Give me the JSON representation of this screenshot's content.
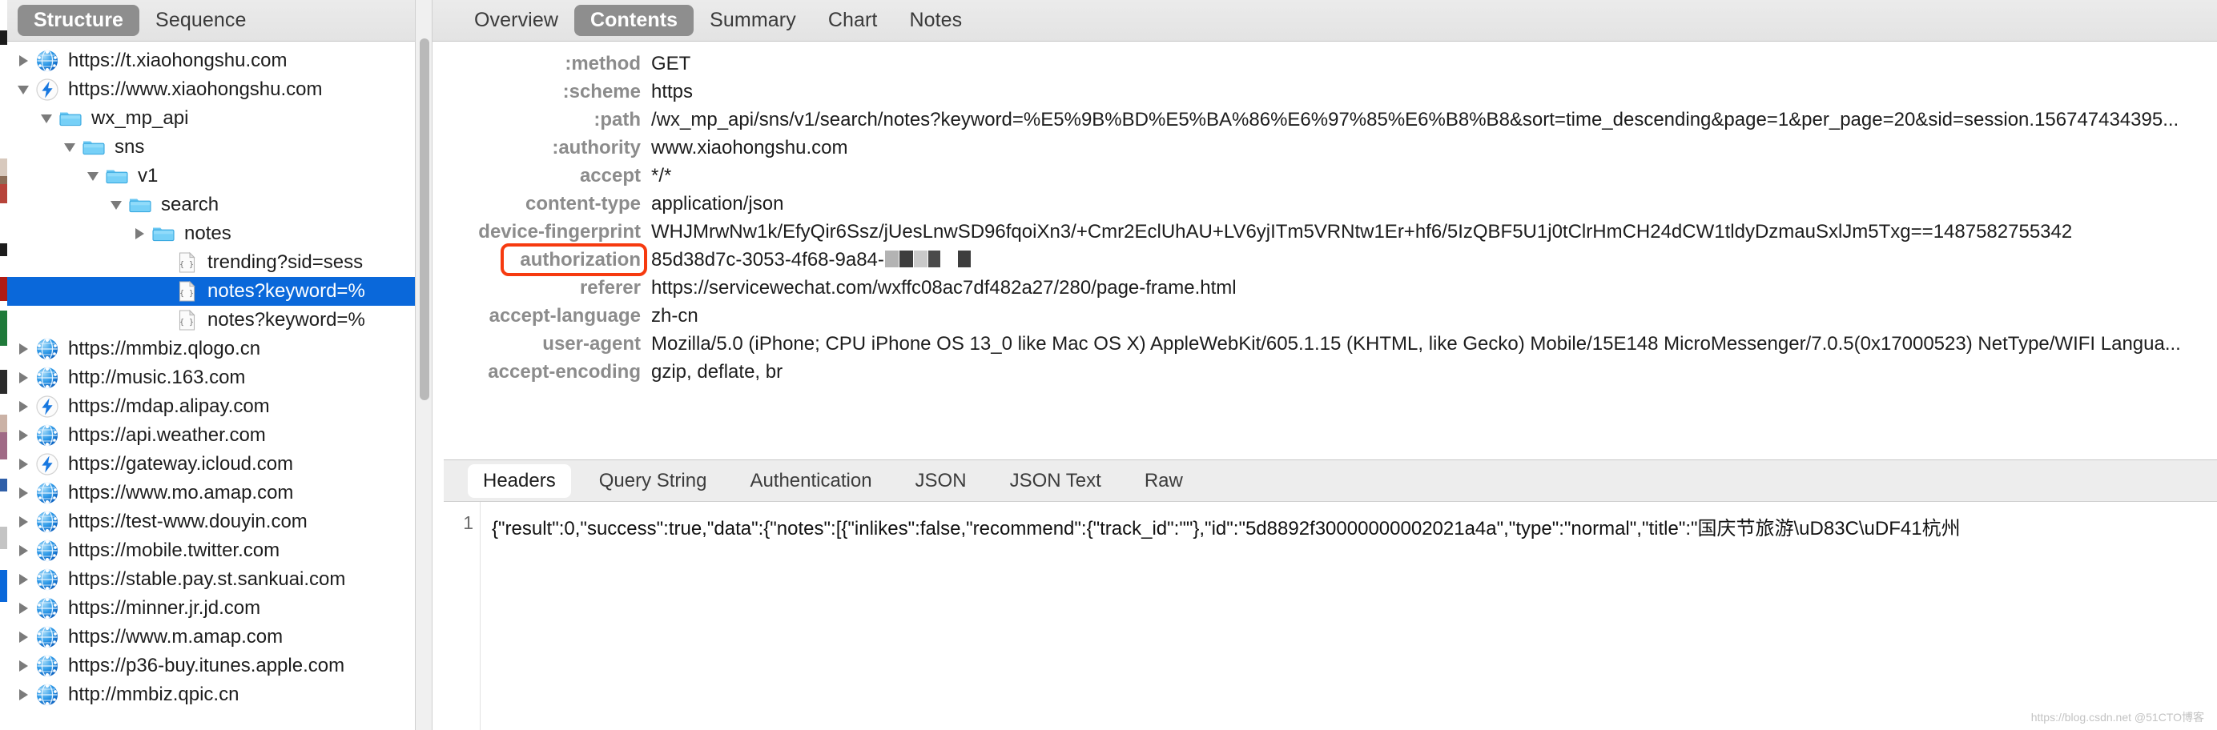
{
  "left_panel": {
    "tabs": [
      {
        "label": "Structure",
        "active": true
      },
      {
        "label": "Sequence",
        "active": false
      }
    ],
    "tree": [
      {
        "label": "https://t.xiaohongshu.com",
        "icon": "globe-icon",
        "indent": 0,
        "twisty": "closed",
        "selected": false
      },
      {
        "label": "https://www.xiaohongshu.com",
        "icon": "bolt-icon",
        "indent": 0,
        "twisty": "open",
        "selected": false
      },
      {
        "label": "wx_mp_api",
        "icon": "folder-icon",
        "indent": 1,
        "twisty": "open",
        "selected": false
      },
      {
        "label": "sns",
        "icon": "folder-icon",
        "indent": 2,
        "twisty": "open",
        "selected": false
      },
      {
        "label": "v1",
        "icon": "folder-icon",
        "indent": 3,
        "twisty": "open",
        "selected": false
      },
      {
        "label": "search",
        "icon": "folder-icon",
        "indent": 4,
        "twisty": "open",
        "selected": false
      },
      {
        "label": "notes",
        "icon": "folder-icon",
        "indent": 5,
        "twisty": "closed",
        "selected": false
      },
      {
        "label": "trending?sid=sess",
        "icon": "json-doc-icon",
        "indent": 6,
        "twisty": "none",
        "selected": false
      },
      {
        "label": "notes?keyword=%",
        "icon": "json-doc-icon",
        "indent": 6,
        "twisty": "none",
        "selected": true
      },
      {
        "label": "notes?keyword=%",
        "icon": "json-doc-icon",
        "indent": 6,
        "twisty": "none",
        "selected": false
      },
      {
        "label": "https://mmbiz.qlogo.cn",
        "icon": "globe-icon",
        "indent": 0,
        "twisty": "closed",
        "selected": false
      },
      {
        "label": "http://music.163.com",
        "icon": "globe-icon",
        "indent": 0,
        "twisty": "closed",
        "selected": false
      },
      {
        "label": "https://mdap.alipay.com",
        "icon": "bolt-icon",
        "indent": 0,
        "twisty": "closed",
        "selected": false
      },
      {
        "label": "https://api.weather.com",
        "icon": "globe-icon",
        "indent": 0,
        "twisty": "closed",
        "selected": false
      },
      {
        "label": "https://gateway.icloud.com",
        "icon": "bolt-icon",
        "indent": 0,
        "twisty": "closed",
        "selected": false
      },
      {
        "label": "https://www.mo.amap.com",
        "icon": "globe-icon",
        "indent": 0,
        "twisty": "closed",
        "selected": false
      },
      {
        "label": "https://test-www.douyin.com",
        "icon": "globe-icon",
        "indent": 0,
        "twisty": "closed",
        "selected": false
      },
      {
        "label": "https://mobile.twitter.com",
        "icon": "globe-icon",
        "indent": 0,
        "twisty": "closed",
        "selected": false
      },
      {
        "label": "https://stable.pay.st.sankuai.com",
        "icon": "globe-icon",
        "indent": 0,
        "twisty": "closed",
        "selected": false
      },
      {
        "label": "https://minner.jr.jd.com",
        "icon": "globe-icon",
        "indent": 0,
        "twisty": "closed",
        "selected": false
      },
      {
        "label": "https://www.m.amap.com",
        "icon": "globe-icon",
        "indent": 0,
        "twisty": "closed",
        "selected": false
      },
      {
        "label": "https://p36-buy.itunes.apple.com",
        "icon": "globe-icon",
        "indent": 0,
        "twisty": "closed",
        "selected": false
      },
      {
        "label": "http://mmbiz.qpic.cn",
        "icon": "globe-icon",
        "indent": 0,
        "twisty": "closed",
        "selected": false
      }
    ]
  },
  "right_panel": {
    "tabs": [
      {
        "label": "Overview",
        "active": false
      },
      {
        "label": "Contents",
        "active": true
      },
      {
        "label": "Summary",
        "active": false
      },
      {
        "label": "Chart",
        "active": false
      },
      {
        "label": "Notes",
        "active": false
      }
    ],
    "headers": [
      {
        "key": ":method",
        "value": "GET"
      },
      {
        "key": ":scheme",
        "value": "https"
      },
      {
        "key": ":path",
        "value": "/wx_mp_api/sns/v1/search/notes?keyword=%E5%9B%BD%E5%BA%86%E6%97%85%E6%B8%B8&sort=time_descending&page=1&per_page=20&sid=session.156747434395..."
      },
      {
        "key": ":authority",
        "value": "www.xiaohongshu.com"
      },
      {
        "key": "accept",
        "value": "*/*"
      },
      {
        "key": "content-type",
        "value": "application/json"
      },
      {
        "key": "device-fingerprint",
        "value": "WHJMrwNw1k/EfyQir6Ssz/jUesLnwSD96fqoiXn3/+Cmr2EclUhAU+LV6yjITm5VRNtw1Er+hf6/5IzQBF5U1j0tClrHmCH24dCW1tldyDzmauSxlJm5Txg==1487582755342"
      },
      {
        "key": "authorization",
        "value": "85d38d7c-3053-4f68-9a84-",
        "redacted": true,
        "highlighted": true
      },
      {
        "key": "referer",
        "value": "https://servicewechat.com/wxffc08ac7df482a27/280/page-frame.html"
      },
      {
        "key": "accept-language",
        "value": "zh-cn"
      },
      {
        "key": "user-agent",
        "value": "Mozilla/5.0 (iPhone; CPU iPhone OS 13_0 like Mac OS X) AppleWebKit/605.1.15 (KHTML, like Gecko) Mobile/15E148 MicroMessenger/7.0.5(0x17000523) NetType/WIFI Langua..."
      },
      {
        "key": "accept-encoding",
        "value": "gzip, deflate, br"
      }
    ],
    "lower_tabs": [
      {
        "label": "Headers",
        "active": true
      },
      {
        "label": "Query String",
        "active": false
      },
      {
        "label": "Authentication",
        "active": false
      },
      {
        "label": "JSON",
        "active": false
      },
      {
        "label": "JSON Text",
        "active": false
      },
      {
        "label": "Raw",
        "active": false
      }
    ],
    "body": {
      "line_number": "1",
      "content": "{\"result\":0,\"success\":true,\"data\":{\"notes\":[{\"inlikes\":false,\"recommend\":{\"track_id\":\"\"},\"id\":\"5d8892f30000000002021a4a\",\"type\":\"normal\",\"title\":\"国庆节旅游\\uD83C\\uDF41杭州"
    },
    "watermark": "https://blog.csdn.net  @51CTO博客"
  },
  "colors": {
    "selection_blue": "#0a68da",
    "highlight_red": "#f63a0f",
    "tab_active_gray": "#8e8e8e",
    "key_gray": "#8c8c8c"
  }
}
